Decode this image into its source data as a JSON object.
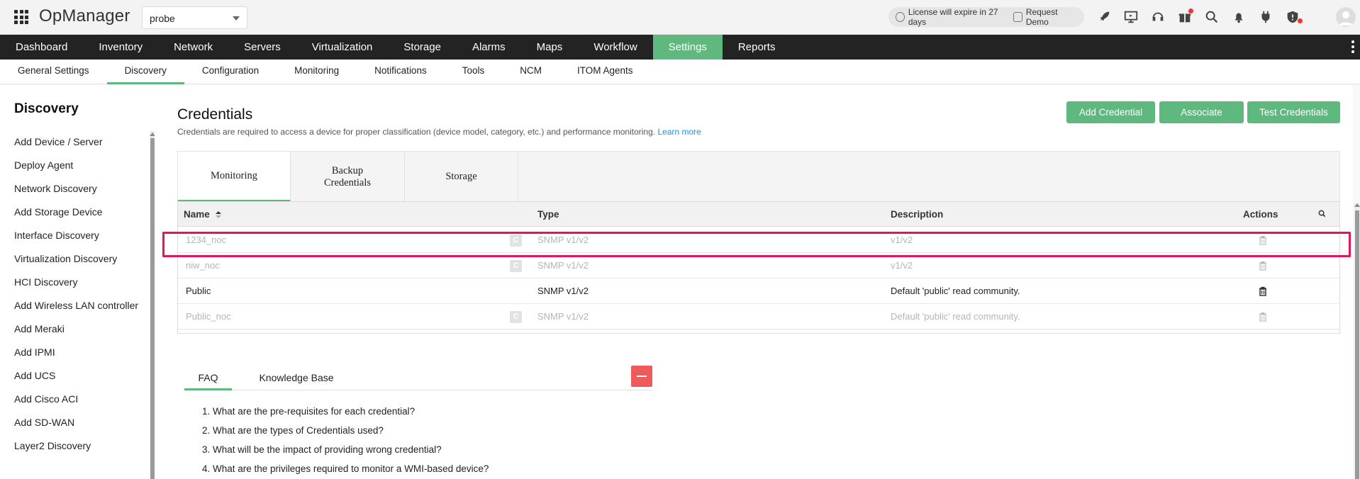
{
  "brand": "OpManager",
  "probe_select": {
    "value": "probe"
  },
  "license": {
    "text": "License will expire in 27 days",
    "demo": "Request Demo"
  },
  "main_nav": [
    "Dashboard",
    "Inventory",
    "Network",
    "Servers",
    "Virtualization",
    "Storage",
    "Alarms",
    "Maps",
    "Workflow",
    "Settings",
    "Reports"
  ],
  "main_nav_active": "Settings",
  "sub_nav": [
    "General Settings",
    "Discovery",
    "Configuration",
    "Monitoring",
    "Notifications",
    "Tools",
    "NCM",
    "ITOM Agents"
  ],
  "sub_nav_active": "Discovery",
  "sidebar": {
    "title": "Discovery",
    "items": [
      "Add Device / Server",
      "Deploy Agent",
      "Network Discovery",
      "Add Storage Device",
      "Interface Discovery",
      "Virtualization Discovery",
      "HCI Discovery",
      "Add Wireless LAN controller",
      "Add Meraki",
      "Add IPMI",
      "Add UCS",
      "Add Cisco ACI",
      "Add SD-WAN",
      "Layer2 Discovery"
    ]
  },
  "page": {
    "title": "Credentials",
    "description": "Credentials are required to access a device for proper classification (device model, category, etc.) and performance monitoring.",
    "learn_more": "Learn more"
  },
  "buttons": {
    "add": "Add Credential",
    "associate": "Associate",
    "test": "Test Credentials"
  },
  "tabs": [
    "Monitoring",
    "Backup Credentials",
    "Storage"
  ],
  "tabs_active": "Monitoring",
  "table": {
    "headers": {
      "name": "Name",
      "type": "Type",
      "description": "Description",
      "actions": "Actions"
    },
    "badge": "C",
    "rows": [
      {
        "name": "1234_noc",
        "type": "SNMP v1/v2",
        "description": "v1/v2",
        "enabled": false
      },
      {
        "name": "niw_noc",
        "type": "SNMP v1/v2",
        "description": "v1/v2",
        "enabled": false
      },
      {
        "name": "Public",
        "type": "SNMP v1/v2",
        "description": "Default 'public' read community.",
        "enabled": true
      },
      {
        "name": "Public_noc",
        "type": "SNMP v1/v2",
        "description": "Default 'public' read community.",
        "enabled": false
      }
    ]
  },
  "faq": {
    "tabs": [
      "FAQ",
      "Knowledge Base"
    ],
    "active": "FAQ",
    "questions": [
      "1. What are the pre-requisites for each credential?",
      "2. What are the types of Credentials used?",
      "3. What will be the impact of providing wrong credential?",
      "4. What are the privileges required to monitor a WMI-based device?"
    ]
  },
  "colors": {
    "accent": "#5fb97f",
    "nav_bg": "#232323",
    "highlight": "#e3165b",
    "collapse": "#ef5b5b",
    "link": "#2b8fd6"
  }
}
